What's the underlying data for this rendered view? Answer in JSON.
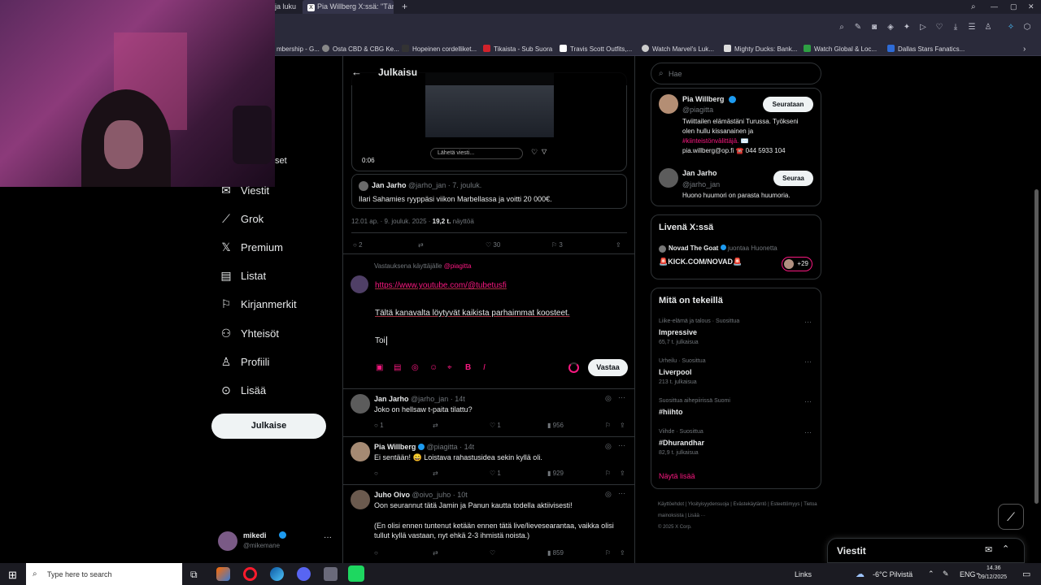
{
  "browser": {
    "tabs": [
      {
        "label": "ja luku"
      },
      {
        "label": "Pia Willberg X:ssä: \"Tämä"
      }
    ],
    "bookmarks": [
      "mbership - G...",
      "Osta CBD & CBG Ke...",
      "Hopeinen cordelliket...",
      "Tikaista - Sub Suora",
      "Travis Scott Outfits,...",
      "Watch Marvel's Luk...",
      "Mighty Ducks: Bank...",
      "Watch Global & Loc...",
      "Dallas Stars Fanatics..."
    ]
  },
  "nav": {
    "items": [
      {
        "label": "set",
        "icon": "bell-icon"
      },
      {
        "label": "Viestit",
        "icon": "mail-icon"
      },
      {
        "label": "Grok",
        "icon": "grok-icon"
      },
      {
        "label": "Premium",
        "icon": "x-logo-icon"
      },
      {
        "label": "Listat",
        "icon": "list-icon"
      },
      {
        "label": "Kirjanmerkit",
        "icon": "bookmark-icon"
      },
      {
        "label": "Yhteisöt",
        "icon": "communities-icon"
      },
      {
        "label": "Profiili",
        "icon": "profile-icon"
      },
      {
        "label": "Lisää",
        "icon": "more-circle-icon"
      }
    ],
    "post_button": "Julkaise",
    "account": {
      "name": "mikedi",
      "handle": "@mikemane"
    }
  },
  "post": {
    "header_title": "Julkaisu",
    "video_time": "0:06",
    "video_reply_placeholder": "Lähetä viesti...",
    "quote": {
      "name": "Jan Jarho",
      "handle": "@jarho_jan",
      "date": "· 7. jouluk.",
      "text": "Ilari Sahamies ryyppäsi viikon Marbellassa ja voitti 20 000€."
    },
    "meta_time": "12.01 ap. · 9. jouluk. 2025 ·",
    "meta_views": "19,2 t.",
    "meta_views_label": "näyttöä",
    "stats": {
      "replies": "2",
      "retweets": "",
      "likes": "30",
      "bookmarks": "3"
    }
  },
  "composer": {
    "replying_to_label": "Vastauksena käyttäjälle",
    "replying_to_handle": "@piagitta",
    "line1": "https://www.youtube.com/@tubetusfi",
    "line2": "Tältä kanavalta löytyvät kaikista parhaimmat koosteet.",
    "line3": "Toi",
    "reply_button": "Vastaa"
  },
  "replies": [
    {
      "name": "Jan Jarho",
      "verified": false,
      "handle": "@jarho_jan",
      "time": "· 14t",
      "text1": "Joko on hellsaw t-paita tilattu?",
      "text2": "",
      "replies": "1",
      "likes": "1",
      "views": "956"
    },
    {
      "name": "Pia Willberg",
      "verified": true,
      "handle": "@piagitta",
      "time": "· 14t",
      "text1": "Ei sentään! 😄 Loistava rahastusidea sekin kyllä oli.",
      "text2": "",
      "replies": "",
      "likes": "1",
      "views": "929"
    },
    {
      "name": "Juho Oivo",
      "verified": false,
      "handle": "@oivo_juho",
      "time": "· 10t",
      "text1": "Oon seurannut tätä Jamin ja Panun kautta todella aktiivisesti!",
      "text2": "(En olisi ennen tuntenut ketään ennen tätä live/lievesearantaa, vaikka olisi tullut kyllä vastaan, nyt ehkä 2-3 ihmistä noista.)",
      "replies": "",
      "likes": "",
      "views": "859"
    }
  ],
  "right": {
    "search_placeholder": "Hae",
    "profiles": [
      {
        "name": "Pia Willberg",
        "handle": "@piagitta",
        "button": "Seurataan",
        "bio1": "Twiittailen elämästäni Turussa. Työkseni",
        "bio2": "olen hullu kissanainen ja",
        "bio3": "#kiinteistönvälittäjä. ✉️",
        "bio4": "pia.willberg@op.fi ☎️ 044 5933 104"
      },
      {
        "name": "Jan Jarho",
        "handle": "@jarho_jan",
        "button": "Seuraa",
        "bio1": "Huono huumori on parasta huumoria."
      }
    ],
    "live": {
      "title": "Livenä X:ssä",
      "host": "Novad The Goat",
      "host_sub": "juontaa Huonetta",
      "stream": "🚨KICK.COM/NOVAD🚨",
      "count": "+29"
    },
    "trends": {
      "title": "Mitä on tekeillä",
      "items": [
        {
          "context": "Liike-elämä ja talous · Suosittua",
          "name": "Impressive",
          "count": "65,7 t. julkaisua"
        },
        {
          "context": "Urheilu · Suosittua",
          "name": "Liverpool",
          "count": "213 t. julkaisua"
        },
        {
          "context": "Suosittua aihepiirissä Suomi",
          "name": "#hiihto",
          "count": ""
        },
        {
          "context": "Viihde · Suosittua",
          "name": "#Dhurandhar",
          "count": "82,9 t. julkaisua"
        }
      ],
      "show_more": "Näytä lisää"
    },
    "footer": [
      "Käyttöehdot",
      "Yksityisyydensuoja",
      "Evästekäytäntö",
      "Esteettömyys",
      "Tietoa mainoksista",
      "Lisää ···",
      "© 2025 X Corp."
    ]
  },
  "messages_drawer": {
    "title": "Viestit"
  },
  "taskbar": {
    "search_placeholder": "Type here to search",
    "links": "Links",
    "weather": "-6°C Pilvistä",
    "lang": "ENG",
    "time": "14.36",
    "date": "09/12/2025"
  },
  "colors": {
    "accent": "#f91880",
    "verified": "#1d9bf0",
    "bg": "#000000"
  }
}
